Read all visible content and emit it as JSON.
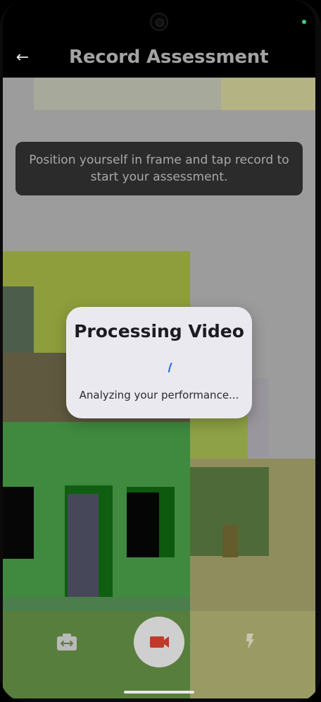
{
  "app_bar": {
    "title": "Record Assessment",
    "back_icon": "arrow-left-icon"
  },
  "camera": {
    "tip_text": "Position yourself in frame and tap record to start your assessment."
  },
  "processing_dialog": {
    "title": "Processing Video",
    "subtitle": "Analyzing your performance...",
    "spinner_color": "#3b6ee8"
  },
  "controls": {
    "flip_icon": "switch-camera-icon",
    "record_icon": "videocam-icon",
    "flash_icon": "flash-icon",
    "record_color": "#c0392b"
  }
}
